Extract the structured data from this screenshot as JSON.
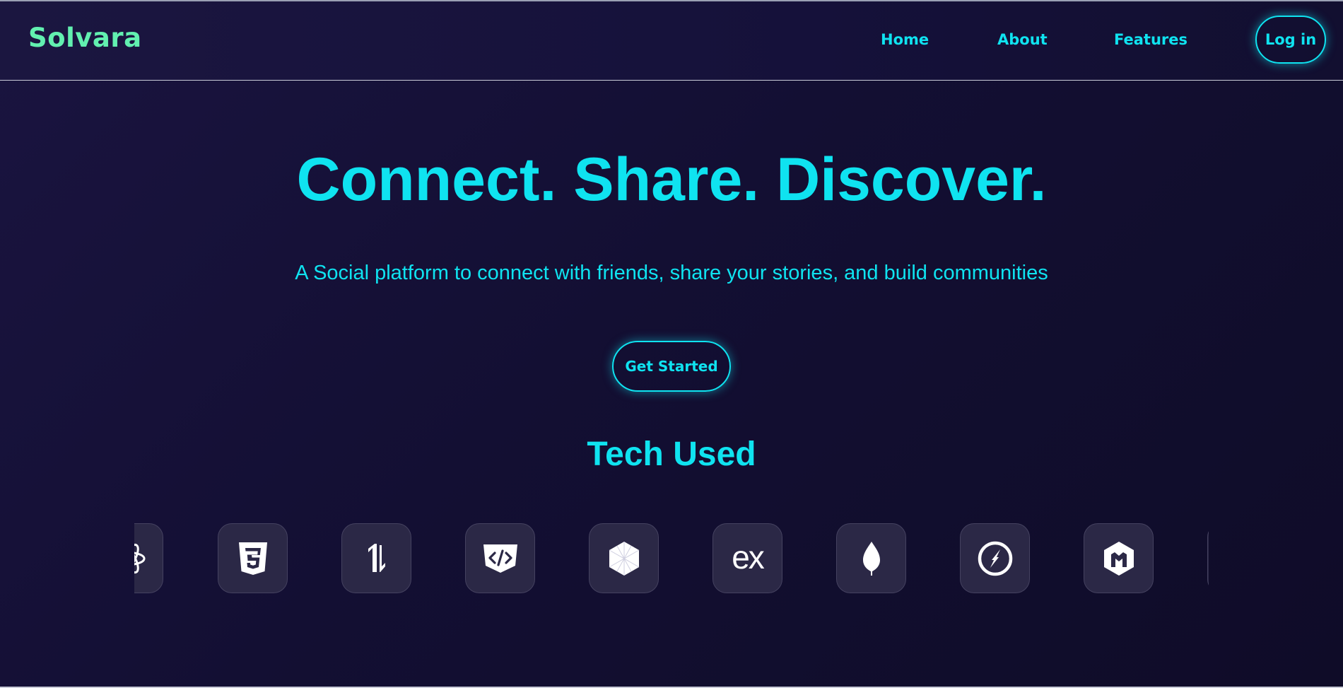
{
  "header": {
    "logo": "Solvara",
    "nav": [
      {
        "label": "Home"
      },
      {
        "label": "About"
      },
      {
        "label": "Features"
      }
    ],
    "login_label": "Log in"
  },
  "hero": {
    "title": "Connect. Share. Discover.",
    "subtitle": "A Social platform to connect with friends, share your stories, and build communities",
    "cta_label": "Get Started"
  },
  "tech": {
    "title": "Tech Used",
    "icons": [
      {
        "name": "react-icon"
      },
      {
        "name": "css3-icon"
      },
      {
        "name": "axios-icon"
      },
      {
        "name": "html-code-icon"
      },
      {
        "name": "electron-hexagon-icon"
      },
      {
        "name": "express-icon",
        "text": "ex"
      },
      {
        "name": "mongodb-icon"
      },
      {
        "name": "socketio-icon"
      },
      {
        "name": "multer-icon"
      },
      {
        "name": "partial-icon"
      }
    ]
  },
  "colors": {
    "accent": "#0fe3f0",
    "logo": "#62f0b0",
    "background": "#130f33",
    "tile": "#2b2846"
  }
}
